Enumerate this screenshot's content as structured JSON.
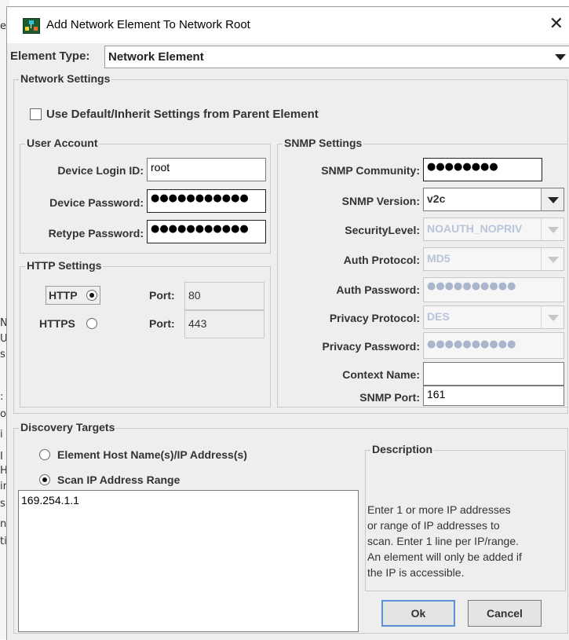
{
  "background": {
    "letters": [
      "e",
      "N",
      "U",
      "s",
      ":",
      "o",
      "i",
      "I",
      "H",
      "in",
      "s",
      "n",
      "ti"
    ]
  },
  "dialog": {
    "title": "Add Network Element To Network Root",
    "close_glyph": "✕"
  },
  "element_type": {
    "label": "Element Type:",
    "value": "Network Element"
  },
  "network_settings": {
    "title": "Network Settings",
    "use_default_label": "Use Default/Inherit Settings from Parent Element"
  },
  "user_account": {
    "title": "User Account",
    "login_label": "Device Login ID:",
    "login_value": "root",
    "password_label": "Device Password:",
    "password_value": "●●●●●●●●●●●",
    "retype_label": "Retype Password:",
    "retype_value": "●●●●●●●●●●●"
  },
  "http_settings": {
    "title": "HTTP Settings",
    "http_label": "HTTP",
    "https_label": "HTTPS",
    "port_label": "Port:",
    "http_port": "80",
    "https_port": "443"
  },
  "snmp": {
    "title": "SNMP Settings",
    "community_label": "SNMP Community:",
    "community_value": "●●●●●●●●",
    "version_label": "SNMP Version:",
    "version_value": "v2c",
    "security_label": "SecurityLevel:",
    "security_value": "NOAUTH_NOPRIV",
    "auth_protocol_label": "Auth Protocol:",
    "auth_protocol_value": "MD5",
    "auth_password_label": "Auth Password:",
    "auth_password_value": "●●●●●●●●●●",
    "privacy_protocol_label": "Privacy Protocol:",
    "privacy_protocol_value": "DES",
    "privacy_password_label": "Privacy Password:",
    "privacy_password_value": "●●●●●●●●●●",
    "context_label": "Context Name:",
    "context_value": "",
    "port_label": "SNMP Port:",
    "port_value": "161"
  },
  "discovery": {
    "title": "Discovery Targets",
    "option_host": "Element Host Name(s)/IP Address(s)",
    "option_range": "Scan IP Address Range",
    "targets_value": "169.254.1.1",
    "description_title": "Description",
    "description_lines": [
      "Enter 1 or more IP addresses",
      "or range of IP addresses to",
      "scan. Enter 1 line per IP/range.",
      "An element will only be added if",
      "the IP is accessible."
    ]
  },
  "buttons": {
    "ok": "Ok",
    "cancel": "Cancel"
  }
}
